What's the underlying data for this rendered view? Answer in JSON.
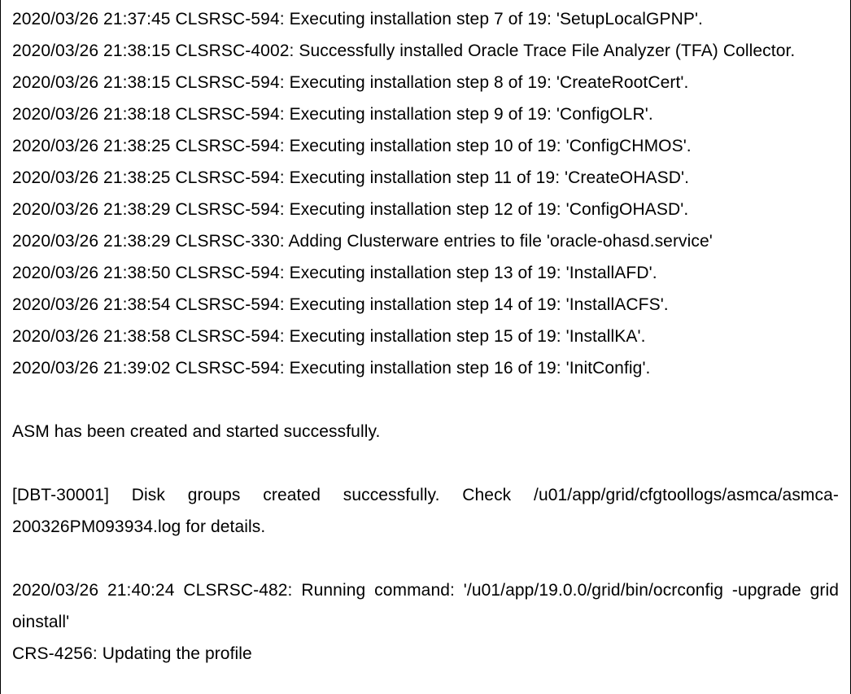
{
  "log": {
    "lines": [
      "2020/03/26 21:37:45 CLSRSC-594: Executing installation step 7 of 19: 'SetupLocalGPNP'.",
      "2020/03/26 21:38:15 CLSRSC-4002: Successfully installed Oracle Trace File Analyzer (TFA) Collector.",
      "2020/03/26 21:38:15 CLSRSC-594: Executing installation step 8 of 19: 'CreateRootCert'.",
      "2020/03/26 21:38:18 CLSRSC-594: Executing installation step 9 of 19: 'ConfigOLR'.",
      "2020/03/26 21:38:25 CLSRSC-594: Executing installation step 10 of 19: 'ConfigCHMOS'.",
      "2020/03/26 21:38:25 CLSRSC-594: Executing installation step 11 of 19: 'CreateOHASD'.",
      "2020/03/26 21:38:29 CLSRSC-594: Executing installation step 12 of 19: 'ConfigOHASD'.",
      "2020/03/26 21:38:29 CLSRSC-330: Adding Clusterware entries to file 'oracle-ohasd.service'",
      "2020/03/26 21:38:50 CLSRSC-594: Executing installation step 13 of 19: 'InstallAFD'.",
      "2020/03/26 21:38:54 CLSRSC-594: Executing installation step 14 of 19: 'InstallACFS'.",
      "2020/03/26 21:38:58 CLSRSC-594: Executing installation step 15 of 19: 'InstallKA'.",
      "2020/03/26 21:39:02 CLSRSC-594: Executing installation step 16 of 19: 'InitConfig'."
    ],
    "asm_msg": "ASM has been created and started successfully.",
    "dbt_msg": "[DBT-30001] Disk groups created successfully. Check /u01/app/grid/cfgtoollogs/asmca/asmca-200326PM093934.log for details.",
    "cmd_msg": "2020/03/26 21:40:24 CLSRSC-482: Running command: '/u01/app/19.0.0/grid/bin/ocrconfig -upgrade grid oinstall'",
    "crs_msg": "CRS-4256: Updating the profile"
  }
}
